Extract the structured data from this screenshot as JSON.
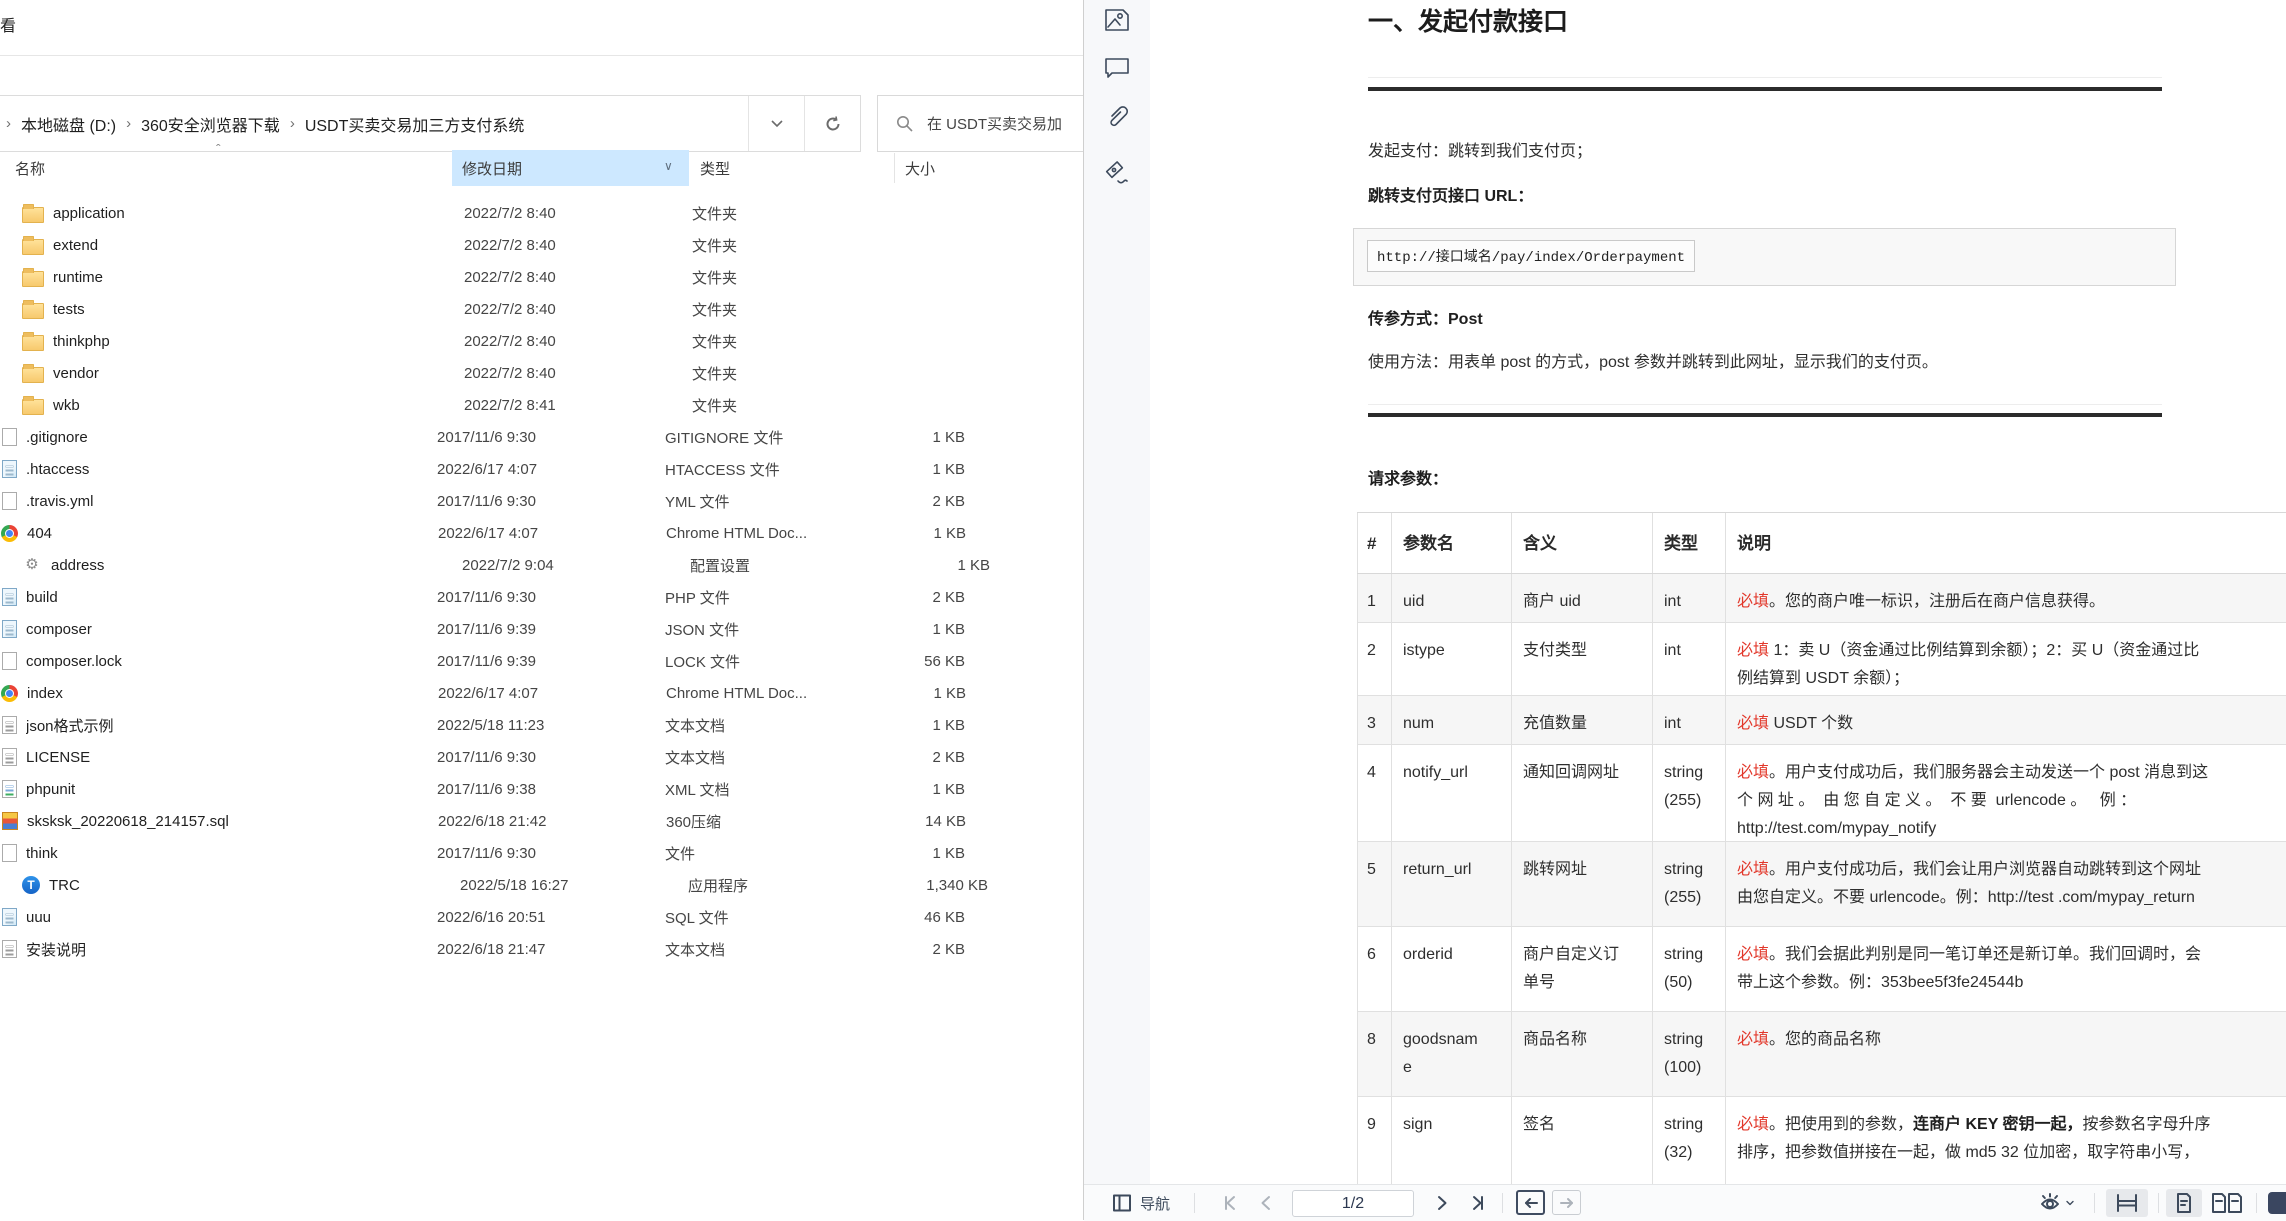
{
  "explorer": {
    "ribbon_tab_partial": "看",
    "breadcrumb": [
      "本地磁盘 (D:)",
      "360安全浏览器下载",
      "USDT买卖交易加三方支付系统"
    ],
    "breadcrumb_sep": "›",
    "address_icons": [
      "chevron-down-icon",
      "refresh-icon"
    ],
    "search": {
      "icon": "search-icon",
      "text": "在 USDT买卖交易加"
    },
    "columns": {
      "name": "名称",
      "date": "修改日期",
      "type": "类型",
      "size": "大小"
    },
    "sort_caret": "ˆ",
    "rows": [
      {
        "name": "application",
        "date": "2022/7/2 8:40",
        "type": "文件夹",
        "size": "",
        "icon": "folder"
      },
      {
        "name": "extend",
        "date": "2022/7/2 8:40",
        "type": "文件夹",
        "size": "",
        "icon": "folder"
      },
      {
        "name": "runtime",
        "date": "2022/7/2 8:40",
        "type": "文件夹",
        "size": "",
        "icon": "folder"
      },
      {
        "name": "tests",
        "date": "2022/7/2 8:40",
        "type": "文件夹",
        "size": "",
        "icon": "folder"
      },
      {
        "name": "thinkphp",
        "date": "2022/7/2 8:40",
        "type": "文件夹",
        "size": "",
        "icon": "folder"
      },
      {
        "name": "vendor",
        "date": "2022/7/2 8:40",
        "type": "文件夹",
        "size": "",
        "icon": "folder"
      },
      {
        "name": "wkb",
        "date": "2022/7/2 8:41",
        "type": "文件夹",
        "size": "",
        "icon": "folder"
      },
      {
        "name": ".gitignore",
        "date": "2017/11/6 9:30",
        "type": "GITIGNORE 文件",
        "size": "1 KB",
        "icon": "doc"
      },
      {
        "name": ".htaccess",
        "date": "2022/6/17 4:07",
        "type": "HTACCESS 文件",
        "size": "1 KB",
        "icon": "note"
      },
      {
        "name": ".travis.yml",
        "date": "2017/11/6 9:30",
        "type": "YML 文件",
        "size": "2 KB",
        "icon": "doc"
      },
      {
        "name": "404",
        "date": "2022/6/17 4:07",
        "type": "Chrome HTML Doc...",
        "size": "1 KB",
        "icon": "chrome"
      },
      {
        "name": "address",
        "date": "2022/7/2 9:04",
        "type": "配置设置",
        "size": "1 KB",
        "icon": "gear"
      },
      {
        "name": "build",
        "date": "2017/11/6 9:30",
        "type": "PHP 文件",
        "size": "2 KB",
        "icon": "note"
      },
      {
        "name": "composer",
        "date": "2017/11/6 9:39",
        "type": "JSON 文件",
        "size": "1 KB",
        "icon": "note"
      },
      {
        "name": "composer.lock",
        "date": "2017/11/6 9:39",
        "type": "LOCK 文件",
        "size": "56 KB",
        "icon": "doc"
      },
      {
        "name": "index",
        "date": "2022/6/17 4:07",
        "type": "Chrome HTML Doc...",
        "size": "1 KB",
        "icon": "chrome"
      },
      {
        "name": "json格式示例",
        "date": "2022/5/18 11:23",
        "type": "文本文档",
        "size": "1 KB",
        "icon": "txt"
      },
      {
        "name": "LICENSE",
        "date": "2017/11/6 9:30",
        "type": "文本文档",
        "size": "2 KB",
        "icon": "txt"
      },
      {
        "name": "phpunit",
        "date": "2017/11/6 9:38",
        "type": "XML 文档",
        "size": "1 KB",
        "icon": "xml"
      },
      {
        "name": "sksksk_20220618_214157.sql",
        "date": "2022/6/18 21:42",
        "type": "360压缩",
        "size": "14 KB",
        "icon": "archive"
      },
      {
        "name": "think",
        "date": "2017/11/6 9:30",
        "type": "文件",
        "size": "1 KB",
        "icon": "doc"
      },
      {
        "name": "TRC",
        "date": "2022/5/18 16:27",
        "type": "应用程序",
        "size": "1,340 KB",
        "icon": "trc"
      },
      {
        "name": "uuu",
        "date": "2022/6/16 20:51",
        "type": "SQL 文件",
        "size": "46 KB",
        "icon": "note"
      },
      {
        "name": "安装说明",
        "date": "2022/6/18 21:47",
        "type": "文本文档",
        "size": "2 KB",
        "icon": "txt"
      }
    ]
  },
  "pdf": {
    "sidebar_icons": [
      "image-icon",
      "comment-icon",
      "attachment-icon",
      "signature-icon"
    ],
    "heading": "一、发起付款接口",
    "para1": "发起支付：跳转到我们支付页；",
    "label_url": "跳转支付页接口 URL：",
    "code_url": "http://接口域名/pay/index/Orderpayment",
    "label_method": "传参方式：Post",
    "para2": "使用方法：用表单 post 的方式，post 参数并跳转到此网址，显示我们的支付页。",
    "label_params": "请求参数：",
    "table": {
      "headers": [
        "#",
        "参数名",
        "含义",
        "类型",
        "说明"
      ],
      "rows": [
        {
          "num": "1",
          "param": [
            "uid"
          ],
          "meaning": [
            "商户 uid"
          ],
          "type": [
            "int"
          ],
          "desc": [
            [
              {
                "t": "必填",
                "red": true
              },
              {
                "t": "。您的商户唯一标识，注册后在商户信息获得。"
              }
            ]
          ]
        },
        {
          "num": "2",
          "param": [
            "istype"
          ],
          "meaning": [
            "支付类型"
          ],
          "type": [
            "int"
          ],
          "desc": [
            [
              {
                "t": "必填",
                "red": true
              },
              {
                "t": " 1：卖 U（资金通过比例结算到余额）；2：买 U（资金通过比"
              }
            ],
            [
              {
                "t": "例结算到 USDT 余额）；"
              }
            ]
          ]
        },
        {
          "num": "3",
          "param": [
            "num"
          ],
          "meaning": [
            "充值数量"
          ],
          "type": [
            "int"
          ],
          "desc": [
            [
              {
                "t": "必填",
                "red": true
              },
              {
                "t": " USDT 个数"
              }
            ]
          ]
        },
        {
          "num": "4",
          "param": [
            "notify_url"
          ],
          "meaning": [
            "通知回调网址"
          ],
          "type": [
            "string",
            "(255)"
          ],
          "desc": [
            [
              {
                "t": "必填",
                "red": true
              },
              {
                "t": "。用户支付成功后，我们服务器会主动发送一个 post 消息到这"
              }
            ],
            [
              {
                "t": "个 网 址 。  由 您 自 定 义 。  不 要  urlencode 。   例 ："
              }
            ],
            [
              {
                "t": "http://test.com/mypay_notify"
              }
            ]
          ]
        },
        {
          "num": "5",
          "param": [
            "return_url"
          ],
          "meaning": [
            "跳转网址"
          ],
          "type": [
            "string",
            "(255)"
          ],
          "desc": [
            [
              {
                "t": "必填",
                "red": true
              },
              {
                "t": "。用户支付成功后，我们会让用户浏览器自动跳转到这个网址"
              }
            ],
            [
              {
                "t": "由您自定义。不要 urlencode。例：http://test .com/mypay_return"
              }
            ]
          ]
        },
        {
          "num": "6",
          "param": [
            "orderid"
          ],
          "meaning": [
            "商户自定义订",
            "单号"
          ],
          "type": [
            "string",
            "(50)"
          ],
          "desc": [
            [
              {
                "t": "必填",
                "red": true
              },
              {
                "t": "。我们会据此判别是同一笔订单还是新订单。我们回调时，会"
              }
            ],
            [
              {
                "t": "带上这个参数。例：353bee5f3fe24544b"
              }
            ]
          ]
        },
        {
          "num": "8",
          "param": [
            "goodsnam",
            "e"
          ],
          "meaning": [
            "商品名称"
          ],
          "type": [
            "string",
            "(100)"
          ],
          "desc": [
            [
              {
                "t": "必填",
                "red": true
              },
              {
                "t": "。您的商品名称"
              }
            ]
          ]
        },
        {
          "num": "9",
          "param": [
            "sign"
          ],
          "meaning": [
            "签名"
          ],
          "type": [
            "string",
            "(32)"
          ],
          "desc": [
            [
              {
                "t": "必填",
                "red": true
              },
              {
                "t": "。把使用到的参数，"
              },
              {
                "t": "连商户 KEY 密钥一起，",
                "b": true
              },
              {
                "t": "按参数名字母升序"
              }
            ],
            [
              {
                "t": "排序，把参数值拼接在一起，做 md5 32 位加密，取字符串小写，"
              }
            ]
          ]
        }
      ]
    },
    "toolbar": {
      "nav_label": "导航",
      "page_indicator": "1/2",
      "icons": [
        "nav-panel-icon",
        "first-page-icon",
        "prev-page-icon",
        "next-page-icon",
        "last-page-icon",
        "back-icon",
        "forward-icon",
        "eye-protect-icon",
        "fit-width-icon",
        "single-page-icon",
        "two-page-icon"
      ]
    }
  }
}
